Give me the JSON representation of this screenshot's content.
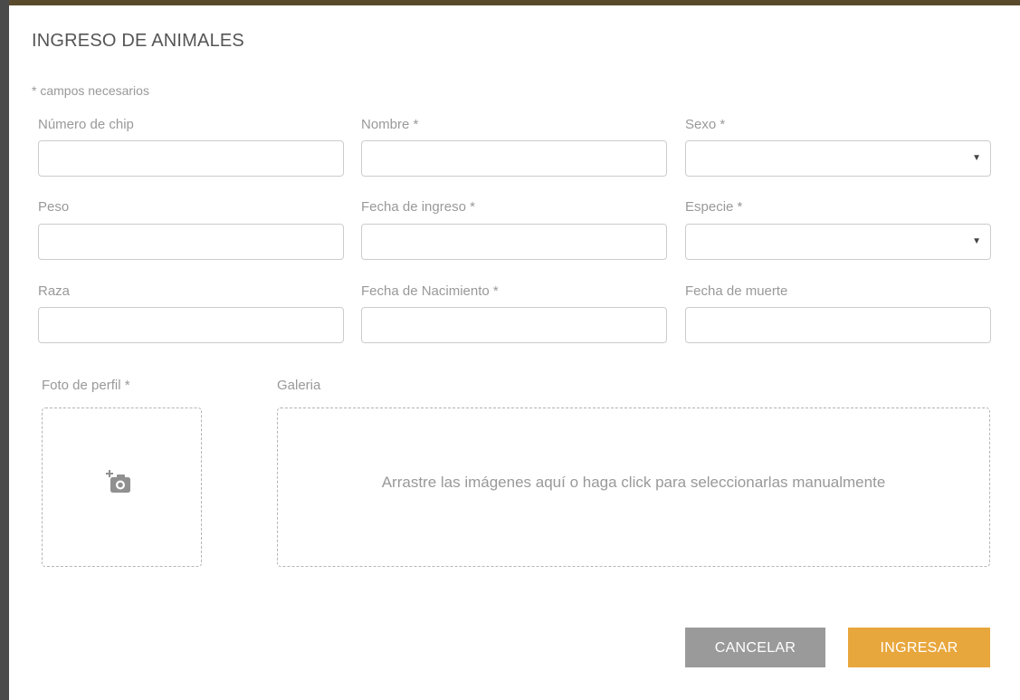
{
  "modal": {
    "title": "INGRESO DE ANIMALES",
    "required_note": "* campos necesarios"
  },
  "fields": {
    "chip": {
      "label": "Número de chip",
      "value": ""
    },
    "nombre": {
      "label": "Nombre *",
      "value": ""
    },
    "sexo": {
      "label": "Sexo *",
      "selected": ""
    },
    "peso": {
      "label": "Peso",
      "value": ""
    },
    "fecha_ingreso": {
      "label": "Fecha de ingreso *",
      "value": ""
    },
    "especie": {
      "label": "Especie *",
      "selected": ""
    },
    "raza": {
      "label": "Raza",
      "value": ""
    },
    "fecha_nacimiento": {
      "label": "Fecha de Nacimiento *",
      "value": ""
    },
    "fecha_muerte": {
      "label": "Fecha de muerte",
      "value": ""
    }
  },
  "uploads": {
    "profile_photo": {
      "label": "Foto de perfil *",
      "icon": "add-photo-icon"
    },
    "gallery": {
      "label": "Galeria",
      "hint": "Arrastre las imágenes aquí o haga click para seleccionarlas manualmente"
    }
  },
  "actions": {
    "cancel_label": "CANCELAR",
    "submit_label": "INGRESAR"
  },
  "colors": {
    "accent": "#e8a73d",
    "cancel": "#9a9a9a",
    "label": "#999999",
    "title": "#555555"
  },
  "icons": {
    "select_caret": "caret-down-icon"
  }
}
